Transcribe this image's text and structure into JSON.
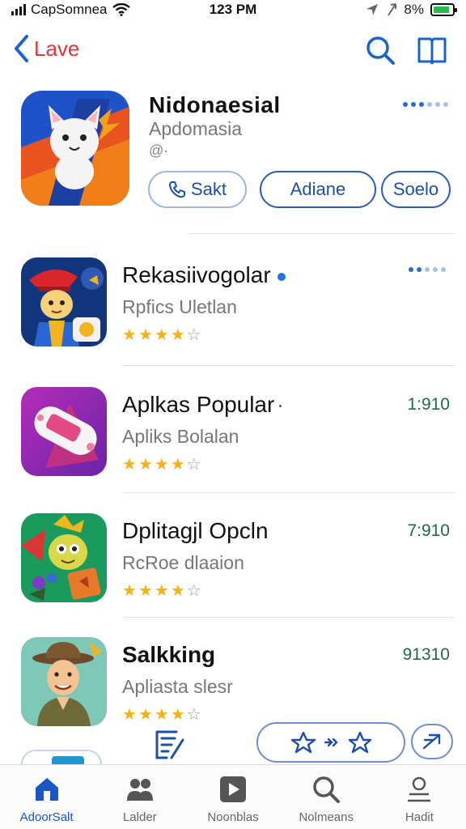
{
  "status_bar": {
    "carrier": "CapSomnea",
    "time": "123 PM",
    "battery_text": "8%",
    "battery_level": 0.85
  },
  "nav": {
    "back_label": "Lave"
  },
  "featured": {
    "name": "Nidonaesial",
    "subtitle": "Apdomasia",
    "meta": "@·",
    "buttons": {
      "call": "Sakt",
      "download": "Adiane",
      "scale": "Soelo"
    }
  },
  "apps": [
    {
      "name": "Rekasiivogolar",
      "subtitle": "Rpfics Uletlan",
      "rating": 4,
      "price": "",
      "verified": true
    },
    {
      "name": "Aplkas Popular",
      "subtitle": "Apliks Bolalan",
      "rating": 4,
      "price": "1:910"
    },
    {
      "name": "Dplitagjl Opcln",
      "subtitle": "RcRoe dlaaion",
      "rating": 4,
      "price": "7:910"
    },
    {
      "name": "Salkking",
      "subtitle": "Apliasta slesr",
      "rating": 4,
      "price": "91310"
    }
  ],
  "tabs": [
    {
      "label": "AdoorSalt",
      "icon": "home-icon",
      "active": true
    },
    {
      "label": "Lalder",
      "icon": "people-icon",
      "active": false
    },
    {
      "label": "Noonblas",
      "icon": "play-icon",
      "active": false
    },
    {
      "label": "Nolmeans",
      "icon": "search-icon",
      "active": false
    },
    {
      "label": "Hadit",
      "icon": "person-icon",
      "active": false
    }
  ],
  "colors": {
    "accent": "#1a63c9",
    "back_label": "#d93a3a",
    "star": "#f2b21a",
    "price": "#1f6b44"
  }
}
